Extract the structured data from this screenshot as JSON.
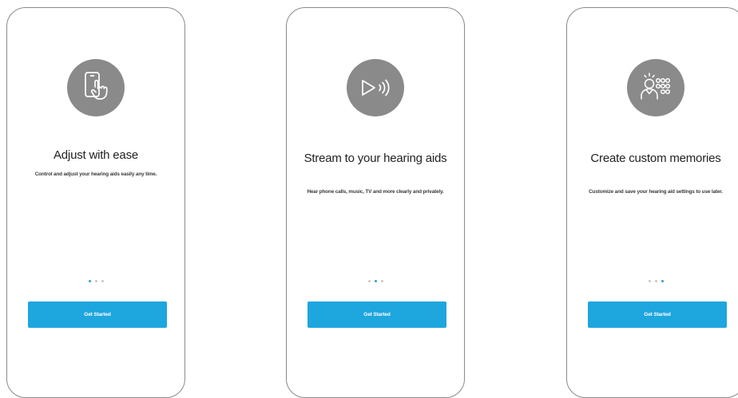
{
  "colors": {
    "accent": "#1ea6de",
    "icon_circle": "#8a8a8a",
    "frame_border": "#8a8a8a",
    "dot_active": "#2a9fd8",
    "dot_inactive": "#c8c8c8"
  },
  "screens": [
    {
      "icon": "phone-touch-icon",
      "title": "Adjust with ease",
      "description": "Control and adjust your hearing aids easily any time.",
      "button_label": "Get Started",
      "page_indicator": {
        "total": 3,
        "active": 1
      }
    },
    {
      "icon": "stream-audio-icon",
      "title": "Stream to your hearing aids",
      "description": "Hear phone calls, music, TV and more clearly and privately.",
      "button_label": "Get Started",
      "page_indicator": {
        "total": 3,
        "active": 2
      }
    },
    {
      "icon": "custom-memories-icon",
      "title": "Create custom memories",
      "description": "Customize and save your hearing aid settings to use later.",
      "button_label": "Get Started",
      "page_indicator": {
        "total": 3,
        "active": 3
      }
    }
  ]
}
